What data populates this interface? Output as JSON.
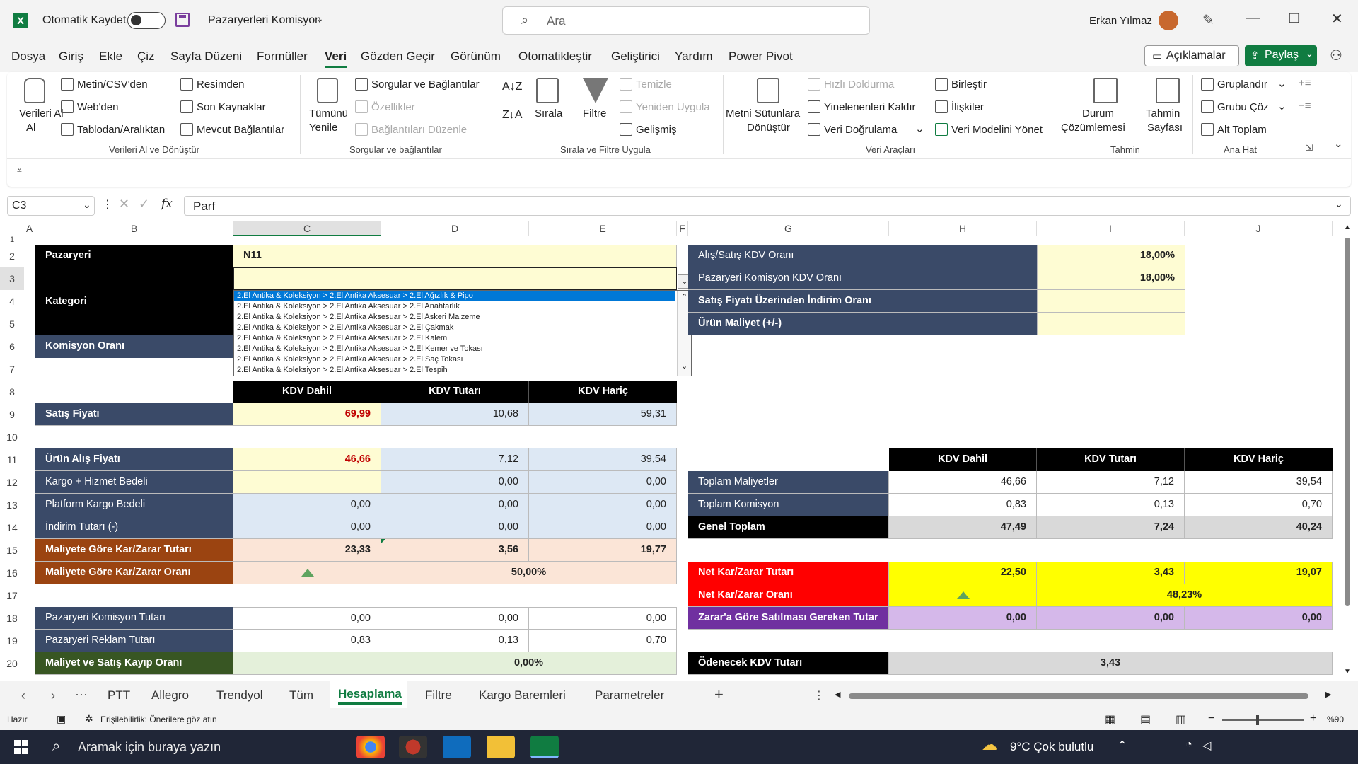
{
  "title": {
    "autosave": "Otomatik Kaydet",
    "doc": "Pazaryerleri Komisyon",
    "search": "Ara",
    "user": "Erkan Yılmaz"
  },
  "menu": [
    "Dosya",
    "Giriş",
    "Ekle",
    "Çiz",
    "Sayfa Düzeni",
    "Formüller",
    "Veri",
    "Gözden Geçir",
    "Görünüm",
    "Otomatikleştir",
    "Geliştirici",
    "Yardım",
    "Power Pivot"
  ],
  "menu_right": {
    "comments": "Açıklamalar",
    "share": "Paylaş"
  },
  "ribbon": {
    "get_data": "Verileri Al",
    "get_data2": "Al",
    "text_csv": "Metin/CSV'den",
    "web": "Web'den",
    "from_table": "Tablodan/Aralıktan",
    "from_picture": "Resimden",
    "recent": "Son Kaynaklar",
    "existing": "Mevcut Bağlantılar",
    "g1": "Verileri Al ve Dönüştür",
    "refresh1": "Tümünü",
    "refresh2": "Yenile",
    "queries": "Sorgular ve Bağlantılar",
    "props": "Özellikler",
    "edit_links": "Bağlantıları Düzenle",
    "g2": "Sorgular ve bağlantılar",
    "sort": "Sırala",
    "filter": "Filtre",
    "clear": "Temizle",
    "reapply": "Yeniden Uygula",
    "advanced": "Gelişmiş",
    "g3": "Sırala ve Filtre Uygula",
    "t2c1": "Metni Sütunlara",
    "t2c2": "Dönüştür",
    "flash": "Hızlı Doldurma",
    "dupes": "Yinelenenleri Kaldır",
    "validation": "Veri Doğrulama",
    "consolidate": "Birleştir",
    "relations": "İlişkiler",
    "model": "Veri Modelini Yönet",
    "g4": "Veri Araçları",
    "whatif1": "Durum",
    "whatif2": "Çözümlemesi",
    "forecast1": "Tahmin",
    "forecast2": "Sayfası",
    "g5": "Tahmin",
    "group": "Gruplandır",
    "ungroup": "Grubu Çöz",
    "subtotal": "Alt Toplam",
    "g6": "Ana Hat"
  },
  "formula": {
    "namebox": "C3",
    "fx": "fx",
    "value": "Parf"
  },
  "columns": [
    "A",
    "B",
    "C",
    "D",
    "E",
    "F",
    "G",
    "H",
    "I",
    "J"
  ],
  "rows": [
    "1",
    "2",
    "3",
    "4",
    "5",
    "6",
    "7",
    "8",
    "9",
    "10",
    "11",
    "12",
    "13",
    "14",
    "15",
    "16",
    "17",
    "18",
    "19",
    "20"
  ],
  "sheet": {
    "pazaryeri": "Pazaryeri",
    "pazaryeri_val": "N11",
    "kategori": "Kategori",
    "komisyon": "Komisyon Oranı",
    "dropdown": [
      "2.El Antika & Koleksiyon > 2.El Antika Aksesuar > 2.El Ağızlık & Pipo",
      "2.El Antika & Koleksiyon > 2.El Antika Aksesuar > 2.El Anahtarlık",
      "2.El Antika & Koleksiyon > 2.El Antika Aksesuar > 2.El Askeri Malzeme",
      "2.El Antika & Koleksiyon > 2.El Antika Aksesuar > 2.El Çakmak",
      "2.El Antika & Koleksiyon > 2.El Antika Aksesuar > 2.El Kalem",
      "2.El Antika & Koleksiyon > 2.El Antika Aksesuar > 2.El Kemer ve Tokası",
      "2.El Antika & Koleksiyon > 2.El Antika Aksesuar > 2.El Saç Tokası",
      "2.El Antika & Koleksiyon > 2.El Antika Aksesuar > 2.El Tespih"
    ],
    "kdv_dahil": "KDV Dahil",
    "kdv_tutari": "KDV Tutarı",
    "kdv_haric": "KDV Hariç",
    "left_rows": [
      {
        "label": "Satış Fiyatı",
        "c": "69,99",
        "d": "10,68",
        "e": "59,31"
      },
      {
        "label": "Ürün Alış Fiyatı",
        "c": "46,66",
        "d": "7,12",
        "e": "39,54"
      },
      {
        "label": "Kargo + Hizmet Bedeli",
        "c": "",
        "d": "0,00",
        "e": "0,00"
      },
      {
        "label": "Platform Kargo Bedeli",
        "c": "0,00",
        "d": "0,00",
        "e": "0,00"
      },
      {
        "label": "İndirim Tutarı (-)",
        "c": "0,00",
        "d": "0,00",
        "e": "0,00"
      },
      {
        "label": "Maliyete Göre Kar/Zarar Tutarı",
        "c": "23,33",
        "d": "3,56",
        "e": "19,77"
      },
      {
        "label": "Maliyete Göre Kar/Zarar Oranı",
        "de": "50,00%"
      },
      {
        "label": "Pazaryeri Komisyon Tutarı",
        "c": "0,00",
        "d": "0,00",
        "e": "0,00"
      },
      {
        "label": "Pazaryeri Reklam Tutarı",
        "c": "0,83",
        "d": "0,13",
        "e": "0,70"
      },
      {
        "label": "Maliyet ve Satış Kayıp Oranı",
        "de": "0,00%"
      }
    ],
    "right_top": [
      {
        "label": "Alış/Satış KDV Oranı",
        "v": "18,00%"
      },
      {
        "label": "Pazaryeri Komisyon KDV Oranı",
        "v": "18,00%"
      },
      {
        "label": "Satış Fiyatı Üzerinden İndirim Oranı",
        "v": ""
      },
      {
        "label": "Ürün Maliyet (+/-)",
        "v": ""
      }
    ],
    "right_rows": [
      {
        "label": "Toplam Maliyetler",
        "h": "46,66",
        "i": "7,12",
        "j": "39,54"
      },
      {
        "label": "Toplam Komisyon",
        "h": "0,83",
        "i": "0,13",
        "j": "0,70"
      },
      {
        "label": "Genel Toplam",
        "h": "47,49",
        "i": "7,24",
        "j": "40,24"
      },
      {
        "label": "Net Kar/Zarar Tutarı",
        "h": "22,50",
        "i": "3,43",
        "j": "19,07"
      },
      {
        "label": "Net Kar/Zarar Oranı",
        "ij": "48,23%"
      },
      {
        "label": "Zarar'a Göre Satılması Gereken Tutar",
        "h": "0,00",
        "i": "0,00",
        "j": "0,00"
      },
      {
        "label": "Ödenecek KDV Tutarı",
        "hij": "3,43"
      }
    ]
  },
  "tabs": [
    "PTT",
    "Allegro",
    "Trendyol",
    "Tüm",
    "Hesaplama",
    "Filtre",
    "Kargo Baremleri",
    "Parametreler"
  ],
  "active_tab": "Hesaplama",
  "status": {
    "ready": "Hazır",
    "access": "Erişilebilirlik: Önerilere göz atın",
    "zoom": "%90"
  },
  "taskbar": {
    "search": "Aramak için buraya yazın",
    "weather": "9°C  Çok bulutlu"
  },
  "colors": {
    "excel_green": "#107c41",
    "navy": "#3a4a68",
    "yellow": "#fefcd3"
  }
}
